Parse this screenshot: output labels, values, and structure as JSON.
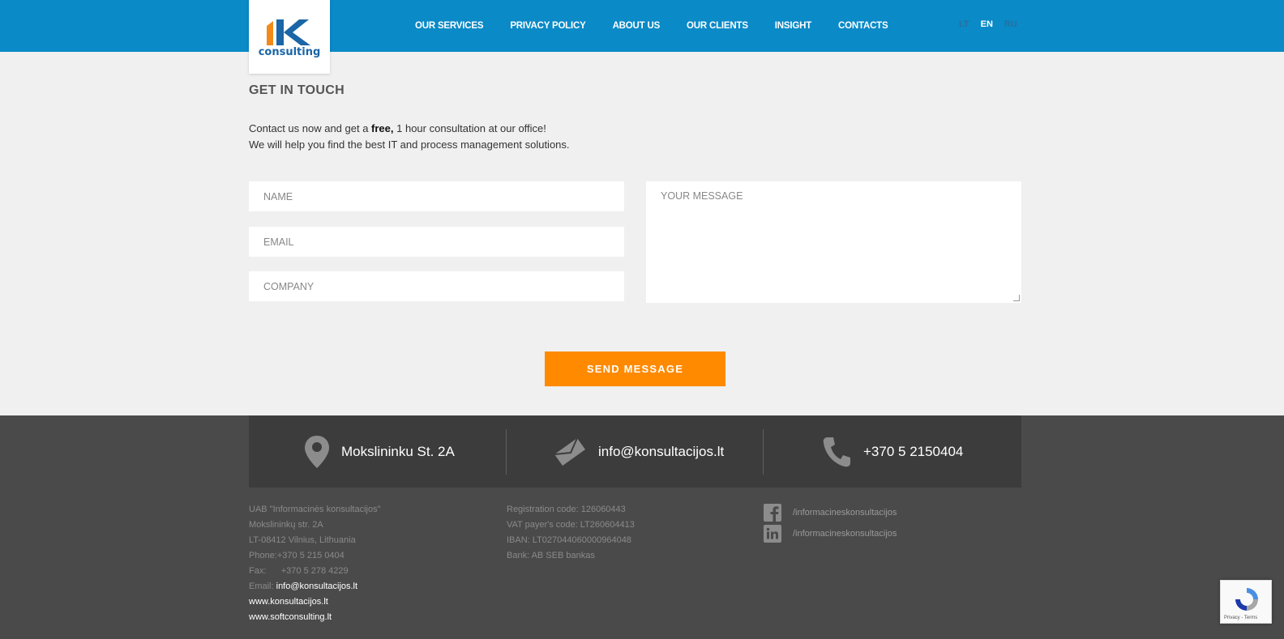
{
  "header": {
    "logo_text": "consulting",
    "nav": [
      "OUR SERVICES",
      "PRIVACY POLICY",
      "ABOUT US",
      "OUR CLIENTS",
      "INSIGHT",
      "CONTACTS"
    ],
    "langs": [
      "LT",
      "EN",
      "RU"
    ],
    "active_lang": "EN"
  },
  "main": {
    "title": "GET IN TOUCH",
    "intro_line1_pre": "Contact us now and get a ",
    "intro_line1_bold": "free,",
    "intro_line1_post": " 1 hour consultation at our office!",
    "intro_line2": "We will help you find the best IT and process management solutions.",
    "placeholders": {
      "name": "NAME",
      "email": "EMAIL",
      "company": "COMPANY",
      "message": "YOUR MESSAGE"
    },
    "send_label": "SEND MESSAGE"
  },
  "footer": {
    "address": "Mokslininku St. 2A",
    "email": "info@konsultacijos.lt",
    "phone": "+370 5 2150404",
    "col1": {
      "company": "UAB \"Informacinės konsultacijos\"",
      "street": "Mokslininkų str. 2A",
      "city": "LT-08412 Vilnius, Lithuania",
      "phone": "Phone:+370 5 215 0404",
      "fax_label": "Fax:",
      "fax": "+370 5 278 4229",
      "email_label": "Email:",
      "email": "info@konsultacijos.lt",
      "web1": "www.konsultacijos.lt",
      "web2": "www.softconsulting.lt"
    },
    "col2": {
      "reg": "Registration code: 126060443",
      "vat": "VAT payer's code: LT260604413",
      "iban": "IBAN: LT027044060000964048",
      "bank": "Bank: AB SEB bankas"
    },
    "social": {
      "facebook": "/informacineskonsultacijos",
      "linkedin": "/informacineskonsultacijos"
    },
    "recaptcha": "Privacy - Terms"
  },
  "colors": {
    "header_blue": "#0a8ac7",
    "accent_orange": "#ff8a00",
    "footer_dark": "#4a4a4a"
  }
}
